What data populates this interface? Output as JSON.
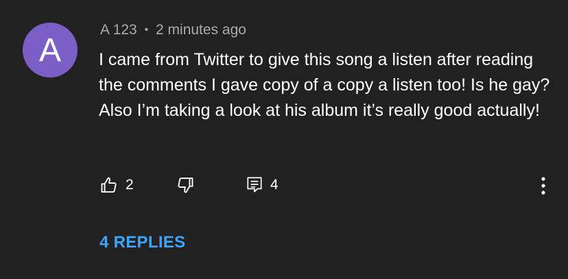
{
  "comment": {
    "avatar_letter": "A",
    "avatar_color": "#7b5fc7",
    "author": "A 123",
    "separator": "•",
    "timestamp": "2 minutes ago",
    "text": "I came from Twitter to give this song a listen after reading the comments I gave copy of a copy a listen too! Is he gay? Also I’m taking a look at his album it’s really good actually!",
    "like_count": "2",
    "reply_count": "4",
    "replies_label": "4 REPLIES"
  },
  "icons": {
    "like": "thumbs-up-icon",
    "dislike": "thumbs-down-icon",
    "reply": "comment-icon",
    "more": "more-vertical-icon"
  },
  "colors": {
    "background": "#212121",
    "meta_text": "#aaaaaa",
    "link": "#3ea6ff"
  }
}
